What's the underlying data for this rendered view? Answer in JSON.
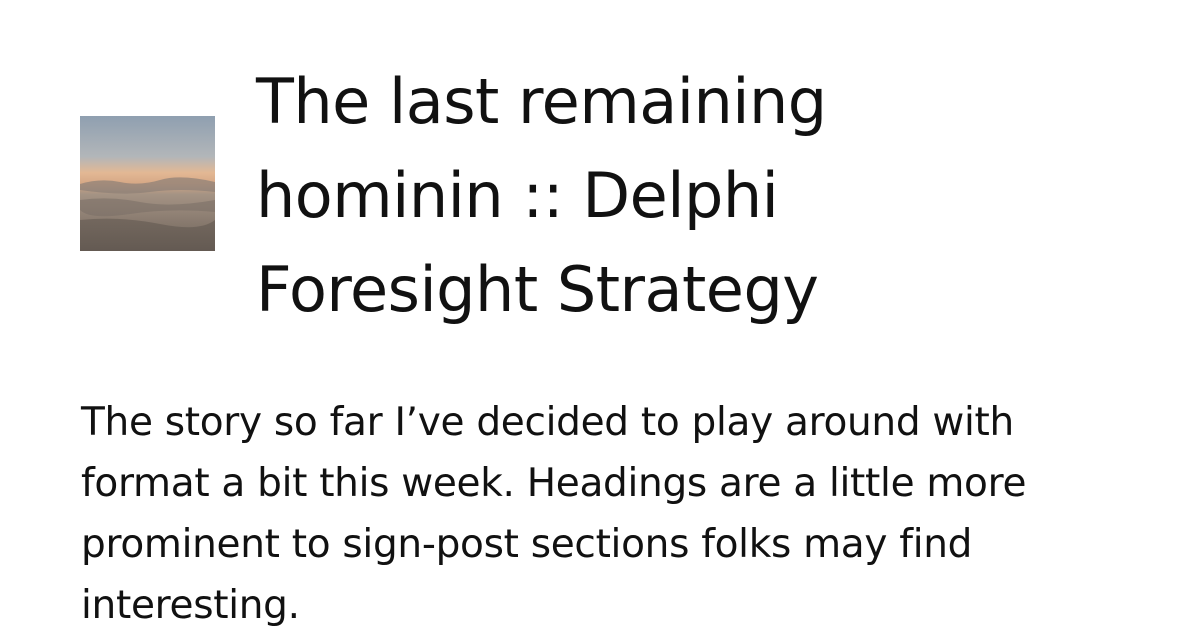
{
  "card": {
    "title": "The last remaining hominin :: Delphi Foresight Strategy",
    "excerpt": "The story so far I’ve decided to play around with format a bit this week. Headings are a little more prominent to sign-post sections folks may find interesting.",
    "thumbnail_icon": "sunset-landscape-image"
  }
}
